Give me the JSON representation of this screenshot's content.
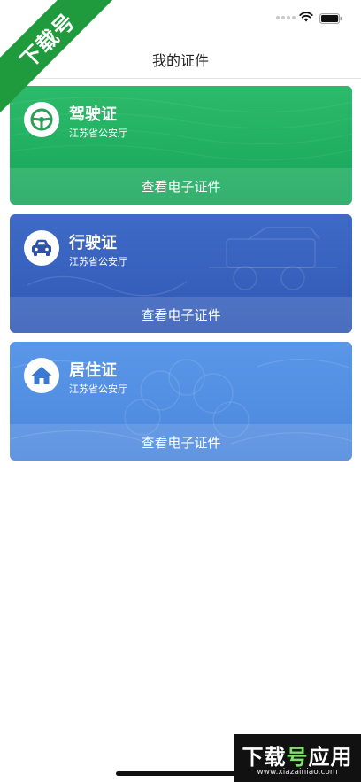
{
  "watermark_badge": {
    "text": "下载号"
  },
  "nav": {
    "title": "我的证件"
  },
  "cards": [
    {
      "title": "驾驶证",
      "subtitle": "江苏省公安厅",
      "action": "查看电子证件",
      "icon": "steering-wheel-icon",
      "color": "#1fae5f"
    },
    {
      "title": "行驶证",
      "subtitle": "江苏省公安厅",
      "action": "查看电子证件",
      "icon": "car-icon",
      "color": "#3760bd"
    },
    {
      "title": "居住证",
      "subtitle": "江苏省公安厅",
      "action": "查看电子证件",
      "icon": "house-icon",
      "color": "#528fe3"
    }
  ],
  "watermark": {
    "brand_a": "下载",
    "brand_b": "号",
    "brand_c": "应用",
    "url": "www.xiazainiao.com"
  }
}
